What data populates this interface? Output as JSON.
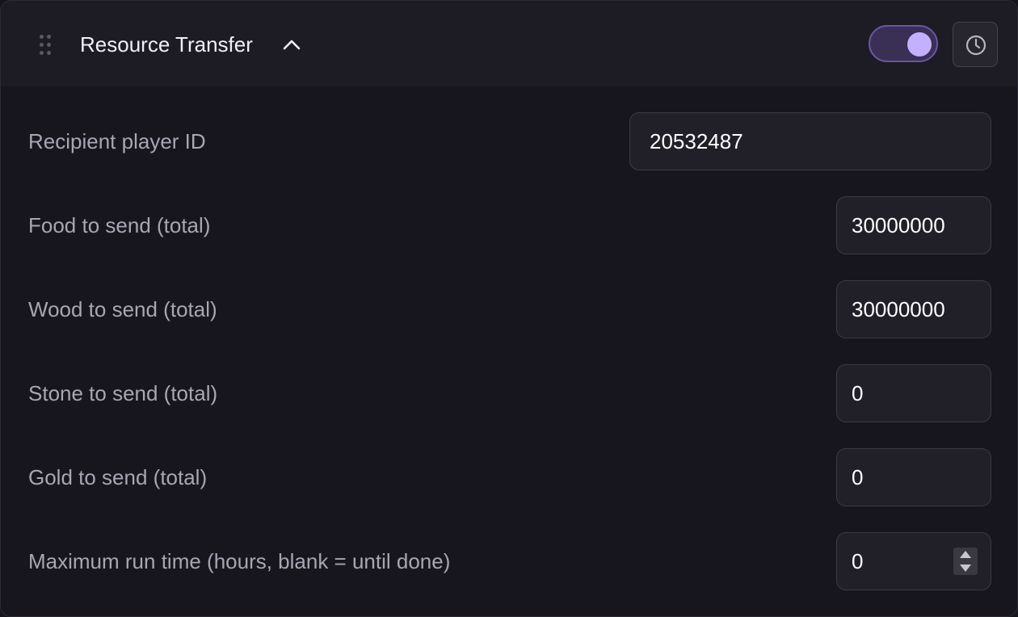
{
  "header": {
    "title": "Resource Transfer",
    "drag_icon": "drag-handle-icon",
    "collapse_icon": "chevron-up-icon",
    "toggle_enabled": true,
    "history_icon": "clock-icon"
  },
  "fields": [
    {
      "label": "Recipient player ID",
      "value": "20532487"
    },
    {
      "label": "Food to send (total)",
      "value": "30000000"
    },
    {
      "label": "Wood to send (total)",
      "value": "30000000"
    },
    {
      "label": "Stone to send (total)",
      "value": "0"
    },
    {
      "label": "Gold to send (total)",
      "value": "0"
    },
    {
      "label": "Maximum run time (hours, blank = until done)",
      "value": "0"
    }
  ],
  "colors": {
    "accent": "#c3b0ff",
    "toggle_track": "#3a2f55",
    "panel_bg": "#17151e",
    "header_bg": "#1d1b24"
  }
}
